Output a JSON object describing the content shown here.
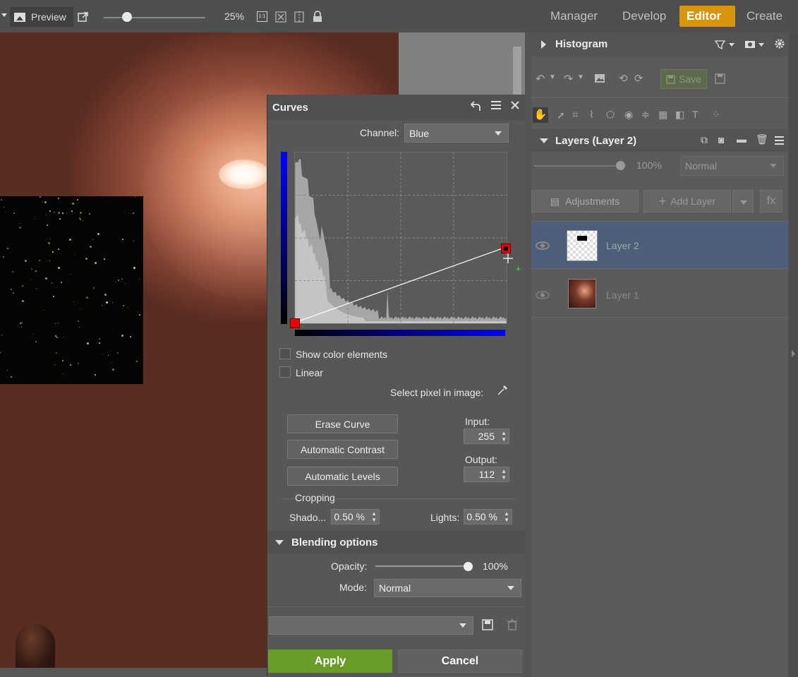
{
  "topbar": {
    "preview_label": "Preview",
    "zoom": "25%",
    "icons": [
      "external-link-icon",
      "zoom-1to1-icon",
      "fit-icon",
      "compare-icon",
      "lock-icon"
    ],
    "tabs": [
      "Manager",
      "Develop",
      "Editor",
      "Create"
    ],
    "active_tab": "Editor",
    "accent_color": "#d7950d"
  },
  "curves": {
    "title": "Curves",
    "channel_label": "Channel:",
    "channel_value": "Blue",
    "show_color_elements": "Show color elements",
    "linear": "Linear",
    "select_pixel": "Select pixel in image:",
    "erase_curve": "Erase Curve",
    "auto_contrast": "Automatic Contrast",
    "auto_levels": "Automatic Levels",
    "input_label": "Input:",
    "input_value": "255",
    "output_label": "Output:",
    "output_value": "112",
    "cropping_label": "Cropping",
    "shadows_label": "Shado...",
    "shadows_value": "0.50 %",
    "lights_label": "Lights:",
    "lights_value": "0.50 %",
    "curve_points": [
      [
        0,
        0
      ],
      [
        255,
        112
      ]
    ]
  },
  "blending": {
    "title": "Blending options",
    "opacity_label": "Opacity:",
    "opacity_value": "100%",
    "mode_label": "Mode:",
    "mode_value": "Normal",
    "preset_value": ""
  },
  "actions": {
    "apply": "Apply",
    "cancel": "Cancel",
    "apply_color": "#6a9c2a"
  },
  "right_panel": {
    "histogram_title": "Histogram",
    "save_label": "Save",
    "layers_title": "Layers (Layer 2)",
    "opacity_value": "100%",
    "blend_mode": "Normal",
    "adjustments_label": "Adjustments",
    "add_layer_label": "Add Layer",
    "fx_label": "fx",
    "layers": [
      {
        "name": "Layer 2",
        "selected": true
      },
      {
        "name": "Layer 1",
        "selected": false
      }
    ]
  }
}
